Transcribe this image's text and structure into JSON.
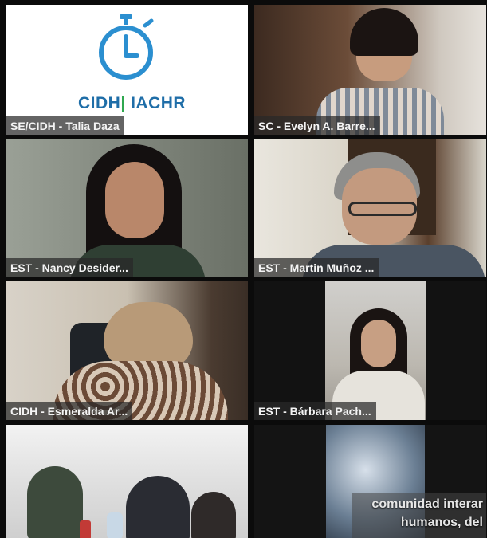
{
  "tiles": [
    {
      "label": "SE/CIDH - Talia Daza"
    },
    {
      "label": "SC - Evelyn A. Barre..."
    },
    {
      "label": "EST - Nancy Desider..."
    },
    {
      "label": "EST - Martin Muñoz ..."
    },
    {
      "label": "CIDH - Esmeralda Ar..."
    },
    {
      "label": "EST - Bárbara Pach..."
    }
  ],
  "logo": {
    "part1": "CIDH",
    "part2": "IACHR",
    "icon": "stopwatch-icon",
    "color_primary": "#1f6ea8",
    "color_accent": "#2fa84f"
  },
  "caption": {
    "line1": "comunidad interar",
    "line2": "humanos, del"
  }
}
